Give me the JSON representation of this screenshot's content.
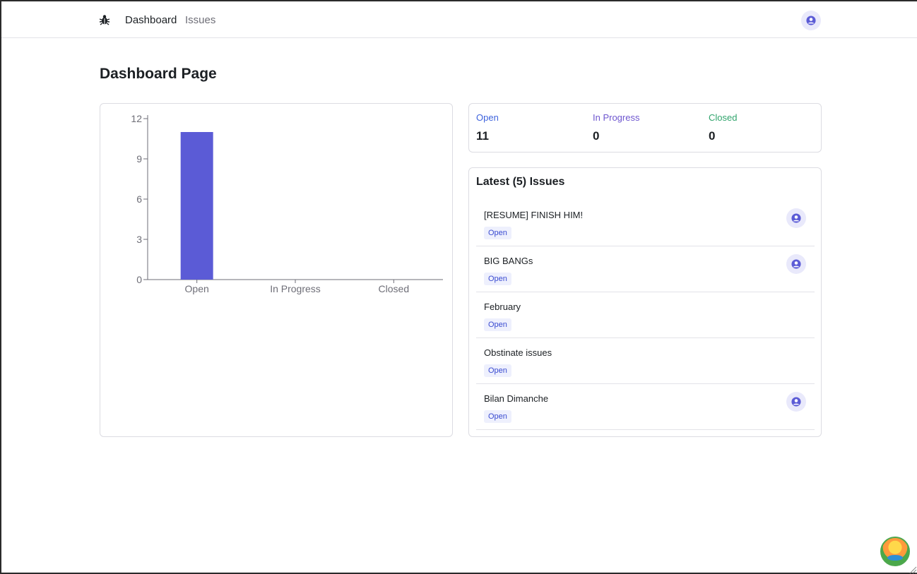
{
  "nav": {
    "logo_icon": "bug-icon",
    "links": [
      {
        "label": "Dashboard",
        "active": true
      },
      {
        "label": "Issues",
        "active": false
      }
    ],
    "avatar_icon": "user-avatar-icon"
  },
  "page": {
    "title": "Dashboard Page"
  },
  "colors": {
    "accent": "#5b5bd6",
    "open": "#3e63dd",
    "in_progress": "#6e56cf",
    "closed": "#30a46c"
  },
  "stats": [
    {
      "label": "Open",
      "value": "11"
    },
    {
      "label": "In Progress",
      "value": "0"
    },
    {
      "label": "Closed",
      "value": "0"
    }
  ],
  "latest": {
    "title": "Latest (5) Issues",
    "issues": [
      {
        "title": "[RESUME] FINISH HIM!",
        "status": "Open",
        "assigned": true
      },
      {
        "title": "BIG BANGs",
        "status": "Open",
        "assigned": true
      },
      {
        "title": "February",
        "status": "Open",
        "assigned": false
      },
      {
        "title": "Obstinate issues",
        "status": "Open",
        "assigned": false
      },
      {
        "title": "Bilan Dimanche",
        "status": "Open",
        "assigned": true
      }
    ]
  },
  "chart_data": {
    "type": "bar",
    "categories": [
      "Open",
      "In Progress",
      "Closed"
    ],
    "values": [
      11,
      0,
      0
    ],
    "ylim": [
      0,
      12
    ],
    "yticks": [
      0,
      3,
      6,
      9,
      12
    ],
    "title": "",
    "xlabel": "",
    "ylabel": "",
    "grid": false
  }
}
